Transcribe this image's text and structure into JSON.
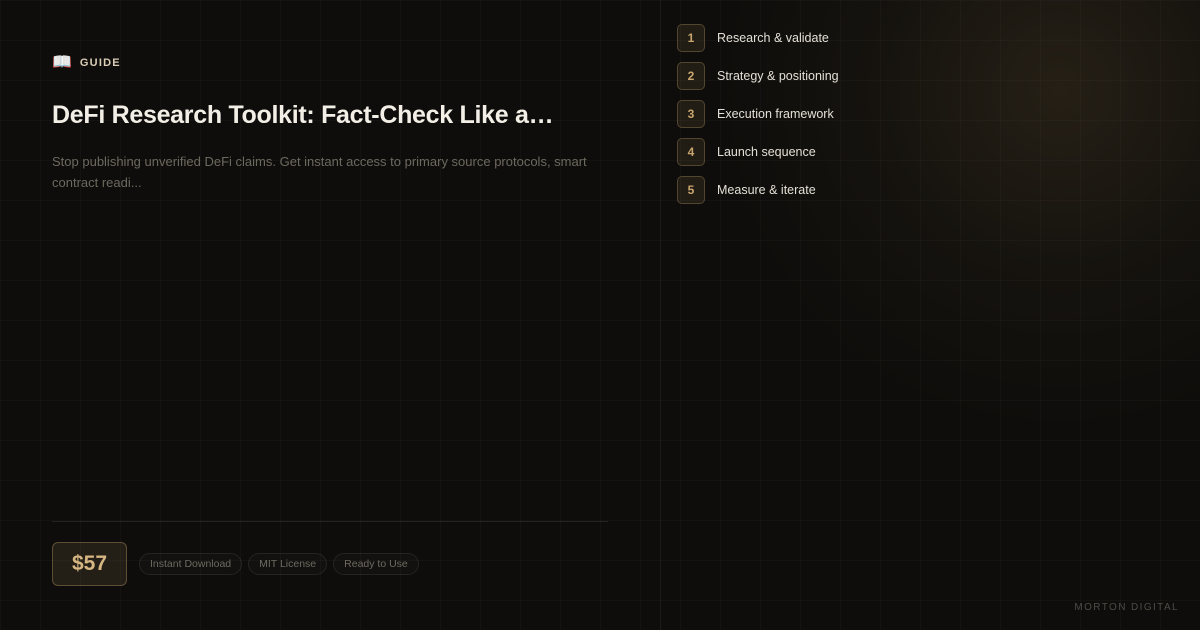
{
  "tag": {
    "icon": "open-book-icon",
    "label": "GUIDE"
  },
  "title": "DeFi Research Toolkit: Fact-Check Like a…",
  "description": "Stop publishing unverified DeFi claims. Get instant access to primary source protocols, smart contract readi...",
  "price": "$57",
  "badges": [
    "Instant Download",
    "MIT License",
    "Ready to Use"
  ],
  "steps": [
    {
      "num": "1",
      "label": "Research & validate"
    },
    {
      "num": "2",
      "label": "Strategy & positioning"
    },
    {
      "num": "3",
      "label": "Execution framework"
    },
    {
      "num": "4",
      "label": "Launch sequence"
    },
    {
      "num": "5",
      "label": "Measure & iterate"
    }
  ],
  "brand": "MORTON DIGITAL",
  "colors": {
    "accent": "#c9a66e",
    "background": "#0e0d0b"
  }
}
